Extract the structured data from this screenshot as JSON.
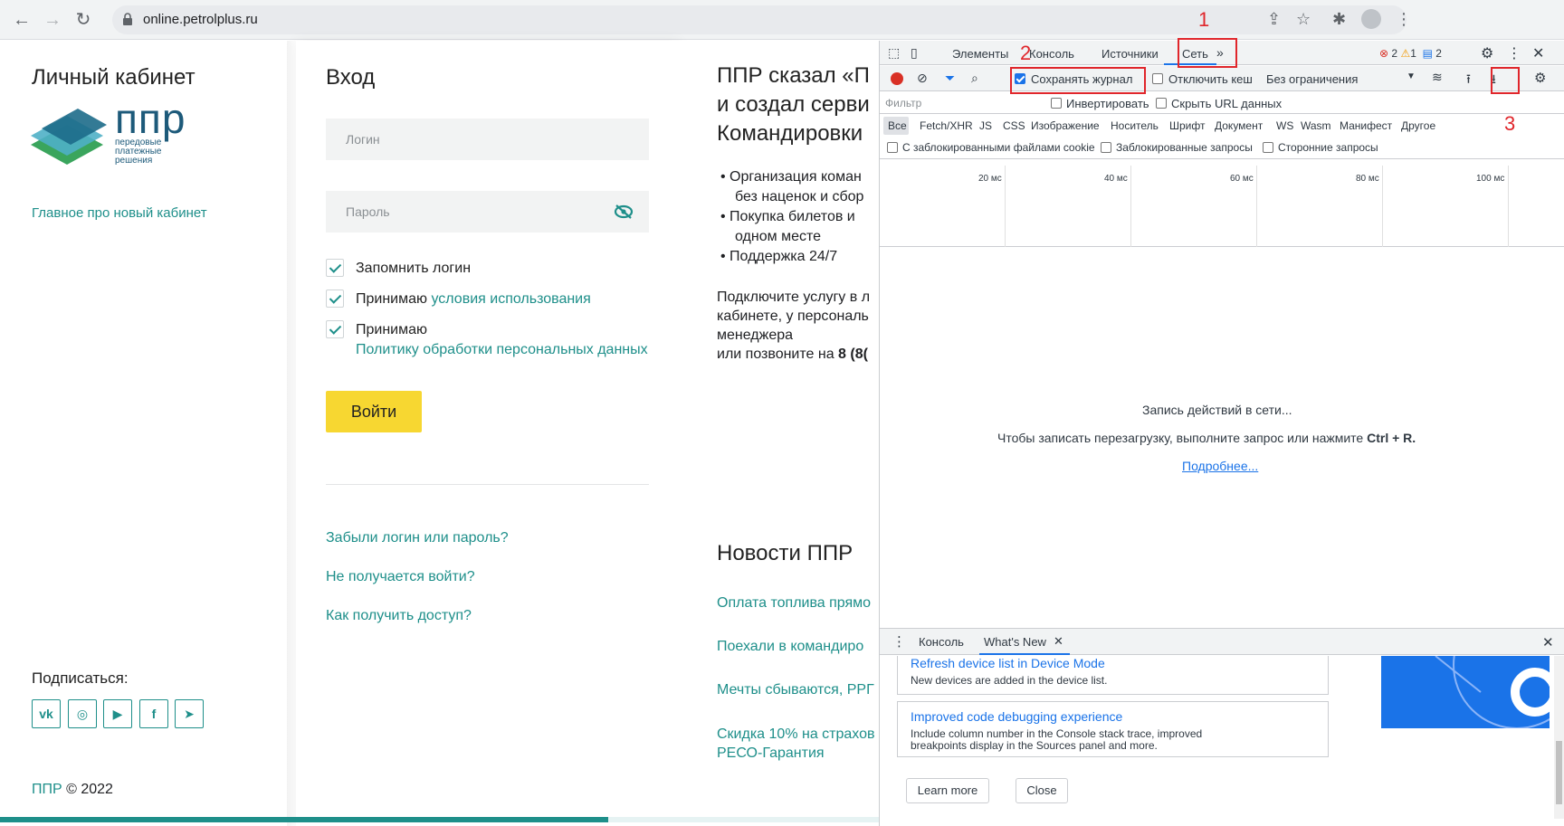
{
  "browser": {
    "url": "online.petrolplus.ru"
  },
  "left": {
    "title": "Личный кабинет",
    "logo_text": "ппр",
    "logo_sub1": "передовые",
    "logo_sub2": "платежные",
    "logo_sub3": "решения",
    "news_link": "Главное про новый кабинет",
    "subscribe": "Подписаться:",
    "social": [
      "vk",
      "ig",
      "yt",
      "fb",
      "tg"
    ],
    "copyright_brand": "ППР",
    "copyright_rest": "© 2022"
  },
  "login": {
    "title": "Вход",
    "login_placeholder": "Логин",
    "password_placeholder": "Пароль",
    "remember": "Запомнить логин",
    "accept1_prefix": "Принимаю",
    "accept1_link": "условия использования",
    "accept2_prefix": "Принимаю",
    "accept2_link": "Политику обработки персональных данных",
    "submit": "Войти",
    "forgot": "Забыли логин или пароль?",
    "cant_login": "Не получается войти?",
    "how_access": "Как получить доступ?"
  },
  "promo": {
    "title_l1": "ППР сказал «П",
    "title_l2": "и создал серви",
    "title_l3": "Командировки",
    "bullet1_l1": "Организация коман",
    "bullet1_l2": "без наценок и сбор",
    "bullet2_l1": "Покупка билетов и",
    "bullet2_l2": "одном месте",
    "bullet3": "Поддержка 24/7",
    "para_l1": "Подключите услугу в л",
    "para_l2": "кабинете, у персональ",
    "para_l3": "менеджера",
    "para_l4": "или позвоните на",
    "para_phone": "8 (8(",
    "news_title": "Новости ППР",
    "news": [
      "Оплата топлива прямо",
      "Поехали в командиро",
      "Мечты сбываются, РРГ",
      "Скидка 10% на страхов"
    ],
    "news_extra": "РЕСО-Гарантия"
  },
  "devtools": {
    "tabs": [
      "Элементы",
      "Консоль",
      "Источники",
      "Сеть"
    ],
    "more_tabs": "»",
    "errors": "2",
    "warnings": "1",
    "messages": "2",
    "preserve_log": "Сохранять журнал",
    "disable_cache": "Отключить кеш",
    "throttle": "Без ограничения",
    "filter_placeholder": "Фильтр",
    "invert": "Инвертировать",
    "hide_urls": "Скрыть URL данных",
    "types": [
      "Все",
      "Fetch/XHR",
      "JS",
      "CSS",
      "Изображение",
      "Носитель",
      "Шрифт",
      "Документ",
      "WS",
      "Wasm",
      "Манифест",
      "Другое"
    ],
    "blocked_cookies": "С заблокированными файлами cookie",
    "blocked_requests": "Заблокированные запросы",
    "third_party": "Сторонние запросы",
    "ticks": [
      "20 мс",
      "40 мс",
      "60 мс",
      "80 мс",
      "100 мс"
    ],
    "recording": "Запись действий в сети...",
    "reload_hint_prefix": "Чтобы записать перезагрузку, выполните запрос или нажмите",
    "reload_hint_keys": "Ctrl + R.",
    "learn_more_link": "Подробнее...",
    "annot1": "1",
    "annot2": "2",
    "annot3": "3",
    "drawer": {
      "tabs": [
        "Консоль",
        "What's New"
      ],
      "card1_title": "Refresh device list in Device Mode",
      "card1_text": "New devices are added in the device list.",
      "card2_title": "Improved code debugging experience",
      "card2_text_l1": "Include column number in the Console stack trace, improved",
      "card2_text_l2": "breakpoints display in the Sources panel and more.",
      "learn_more": "Learn more",
      "close": "Close"
    }
  },
  "colors": {
    "brand_teal": "#1e8f8a",
    "button_yellow": "#f7d731",
    "annotation_red": "#e0262b",
    "devtools_blue": "#1a73e8"
  }
}
